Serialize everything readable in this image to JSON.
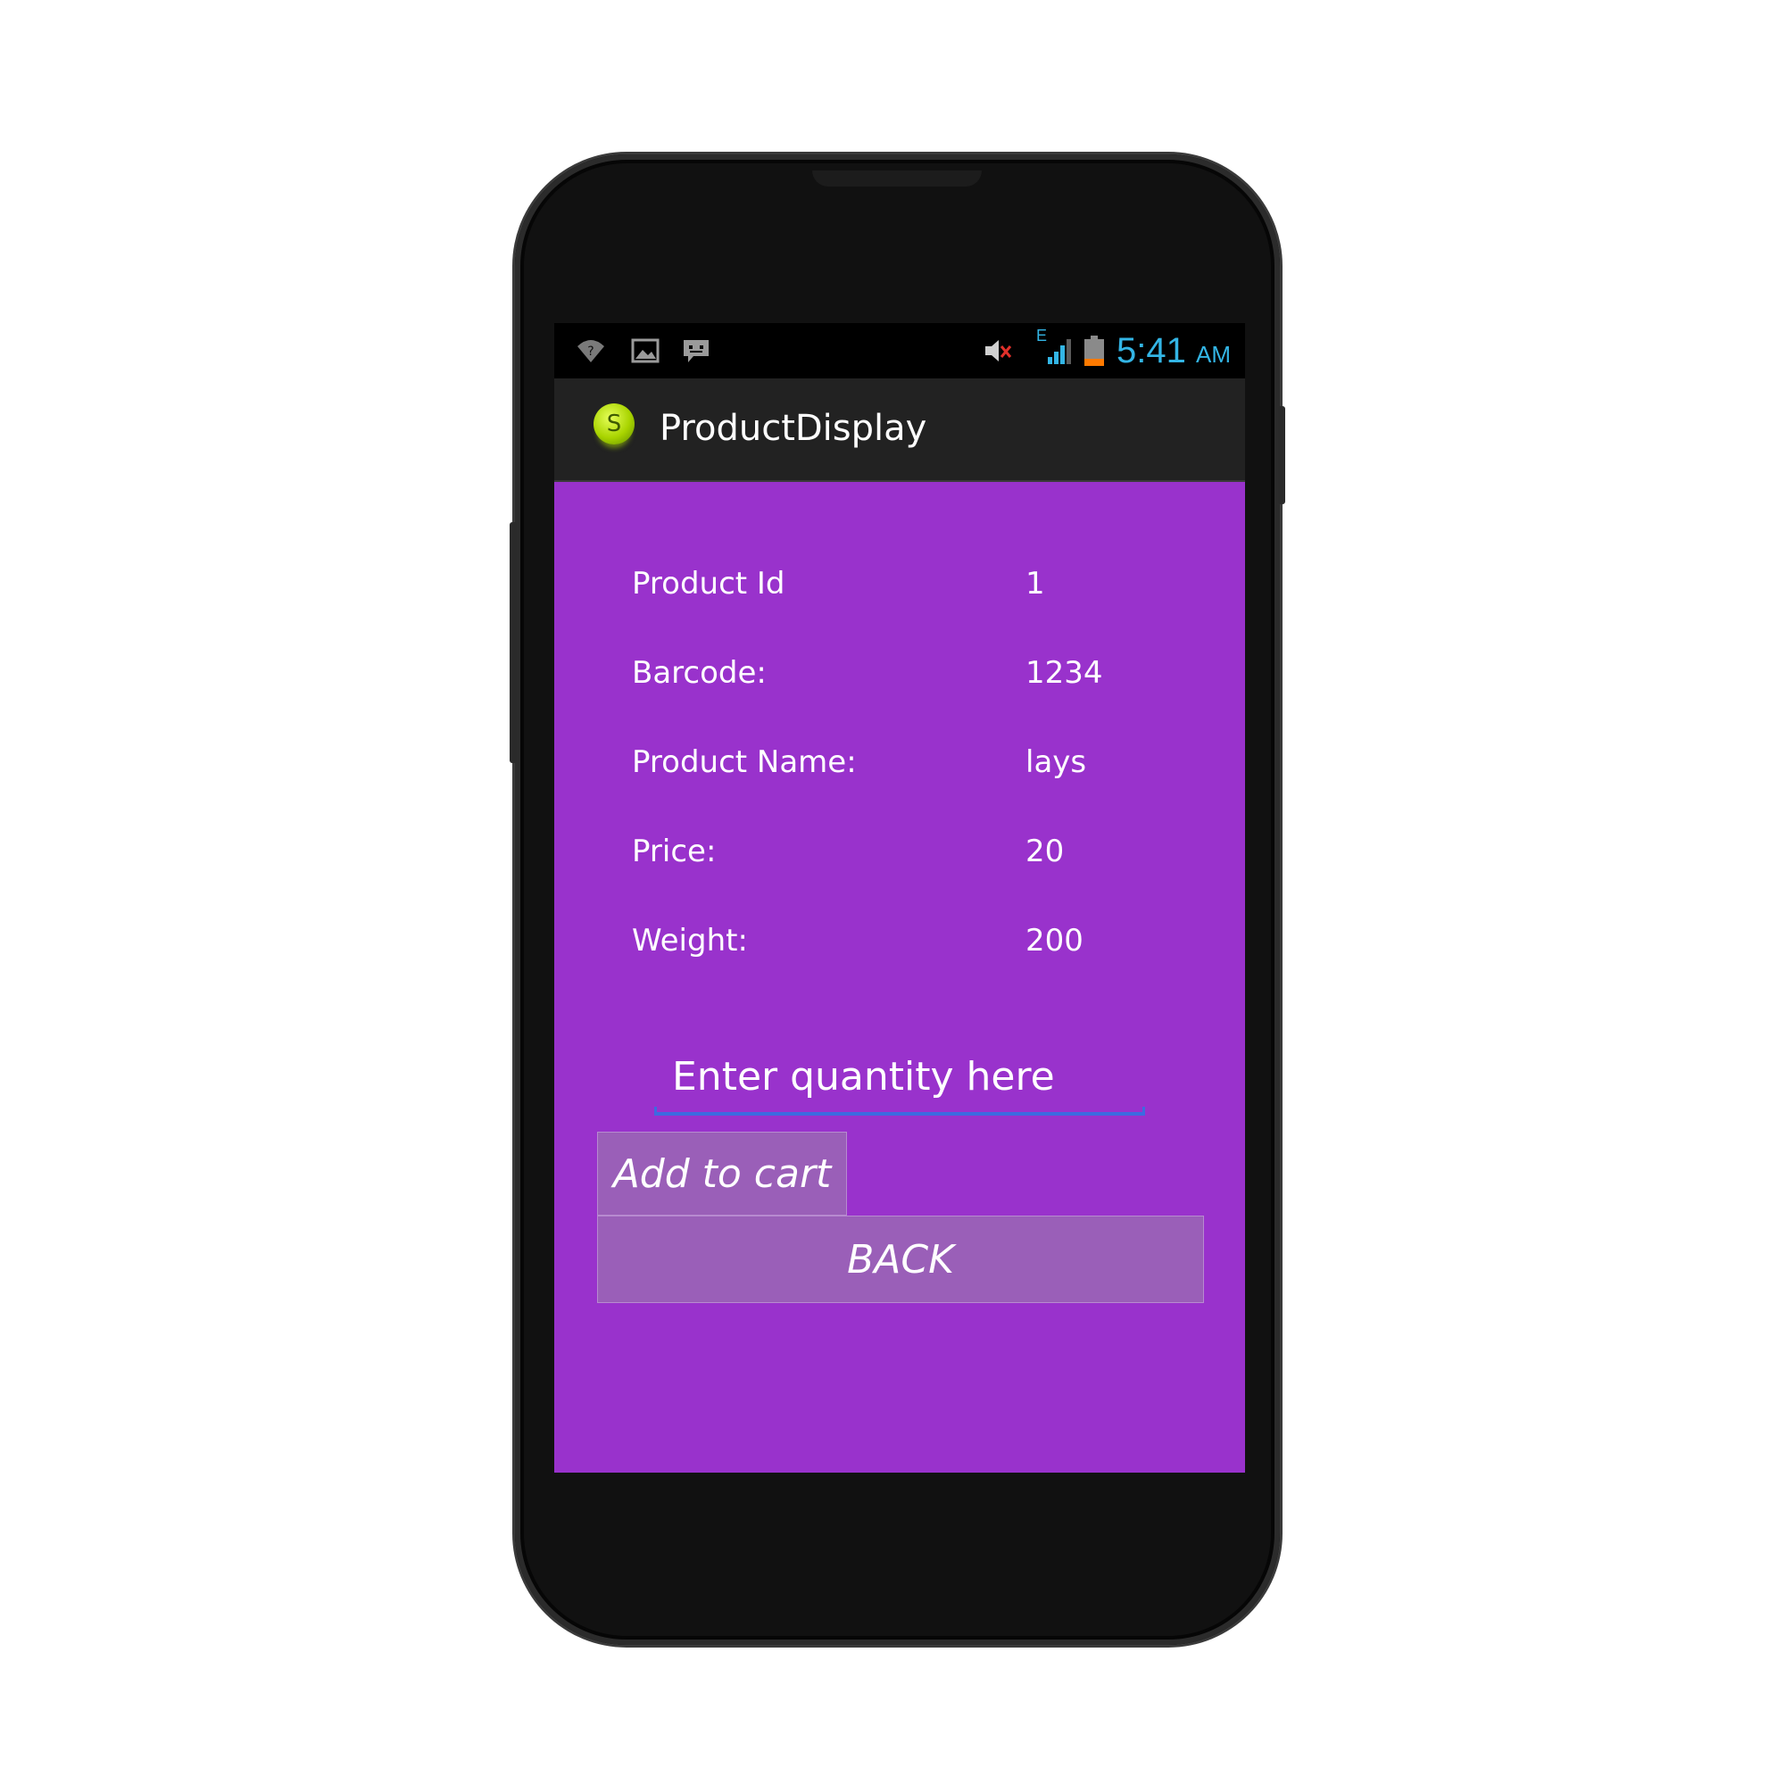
{
  "status_bar": {
    "icons": [
      "wifi-icon",
      "image-notification-icon",
      "chat-notification-icon",
      "muted-volume-icon",
      "signal-icon",
      "battery-icon"
    ],
    "network_letter": "E",
    "time": "5:41",
    "ampm": "AM",
    "time_color": "#33b5e5"
  },
  "action_bar": {
    "icon_letter": "S",
    "title": "ProductDisplay"
  },
  "product": {
    "rows": [
      {
        "label": "Product Id",
        "value": "1"
      },
      {
        "label": "Barcode:",
        "value": "1234"
      },
      {
        "label": "Product Name:",
        "value": "lays"
      },
      {
        "label": "Price:",
        "value": "20"
      },
      {
        "label": "Weight:",
        "value": "200"
      }
    ]
  },
  "quantity_input": {
    "placeholder": "Enter quantity here",
    "value": ""
  },
  "buttons": {
    "add_to_cart": "Add to cart",
    "back": "BACK"
  },
  "colors": {
    "background": "#9932cc",
    "button": "#9a5fb8",
    "input_underline": "#3d6ae0"
  }
}
